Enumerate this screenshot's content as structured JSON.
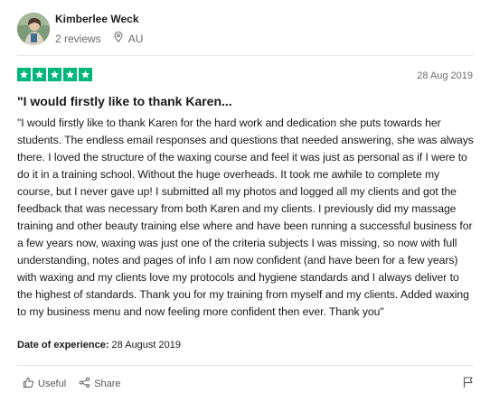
{
  "reviewer": {
    "name": "Kimberlee Weck",
    "reviews": "2 reviews",
    "location": "AU"
  },
  "review": {
    "rating": 5,
    "max_rating": 5,
    "date": "28 Aug 2019",
    "title": "\"I would firstly like to thank Karen...",
    "body": "\"I would firstly like to thank Karen for the hard work and dedication she puts towards her students. The endless email responses and questions that needed answering, she was always there. I loved the structure of the waxing course and feel it was just as personal as if I were to do it in a training school. Without the huge overheads. It took me awhile to complete my course, but I never gave up! I submitted all my photos and logged all my clients and got the feedback that was necessary from both Karen and my clients. I previously did my massage training and other beauty training else where and have been running a successful business for a few years now, waxing was just one of the criteria subjects I was missing, so now with full understanding, notes and pages of info I am now confident (and have been for a few years) with waxing and my clients love my protocols and hygiene standards and I always deliver to the highest of standards. Thank you for my training from myself and my clients. Added waxing to my business menu and now feeling more confident then ever. Thank you\"",
    "experience_label": "Date of experience:",
    "experience_date": "28 August 2019"
  },
  "actions": {
    "useful": "Useful",
    "share": "Share"
  },
  "colors": {
    "star_green": "#00b67a",
    "text": "#191919",
    "muted": "#6b6b6b"
  },
  "icons": [
    "avatar-photo",
    "location-pin-icon",
    "star-icon",
    "thumbs-up-icon",
    "share-icon",
    "flag-icon"
  ]
}
